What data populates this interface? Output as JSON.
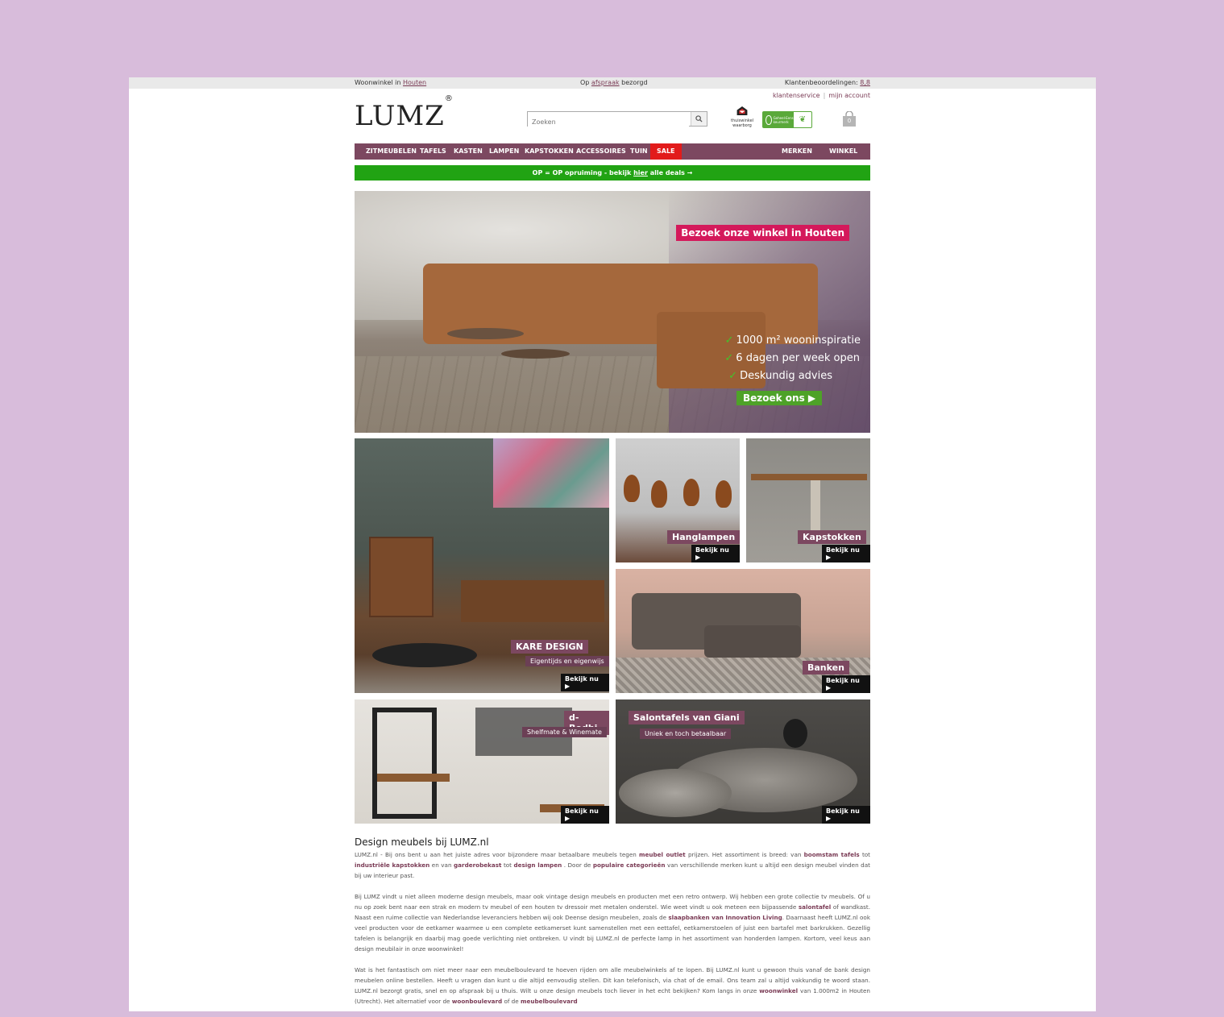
{
  "topbar": {
    "left_prefix": "Woonwinkel in",
    "left_link": "Houten",
    "center_prefix": "Op",
    "center_link": "afspraak",
    "center_suffix": "bezorgd",
    "right_prefix": "Klantenbeoordelingen:",
    "right_rating": "8,8"
  },
  "header": {
    "logo": "LUMZ",
    "logo_mark": "®",
    "account_links": [
      "klantenservice",
      "mijn account"
    ],
    "search_placeholder": "Zoeken",
    "thuiswinkel_label": "thuiswinkel waarborg",
    "keurmerk_label": "Geheel-Eens keurmerk",
    "cart_count": "0"
  },
  "nav": {
    "items": [
      "ZITMEUBELEN",
      "TAFELS",
      "KASTEN",
      "LAMPEN",
      "KAPSTOKKEN",
      "ACCESSOIRES",
      "TUIN",
      "SALE"
    ],
    "right_items": [
      "MERKEN",
      "WINKEL"
    ]
  },
  "promo": {
    "prefix": "OP = OP opruiming - bekijk",
    "link": "hier",
    "suffix": "alle deals →"
  },
  "hero": {
    "tag": "Bezoek onze winkel in Houten",
    "features": [
      "1000 m² wooninspiratie",
      "6 dagen per week open",
      "Deskundig advies"
    ],
    "cta": "Bezoek ons ▶"
  },
  "tiles": {
    "kare": {
      "title": "KARE DESIGN",
      "sub": "Eigentijds en eigenwijs",
      "cta": "Bekijk nu ▶"
    },
    "hanglampen": {
      "title": "Hanglampen",
      "cta": "Bekijk nu ▶"
    },
    "kapstokken": {
      "title": "Kapstokken",
      "cta": "Bekijk nu ▶"
    },
    "banken": {
      "title": "Banken",
      "cta": "Bekijk nu ▶"
    },
    "dbodhi": {
      "title": "d-Bodhi",
      "sub": "Shelfmate & Winemate",
      "cta": "Bekijk nu ▶"
    },
    "giani": {
      "title": "Salontafels van Giani",
      "sub": "Uniek en toch betaalbaar",
      "cta": "Bekijk nu ▶"
    }
  },
  "content": {
    "heading": "Design meubels bij LUMZ.nl",
    "p1": {
      "t1": "LUMZ.nl - Bij ons bent u aan het juiste adres voor bijzondere maar betaalbare meubels tegen ",
      "l1": "meubel outlet",
      "t2": " prijzen. Het assortiment is breed: van ",
      "l2": "boomstam tafels",
      "t3": " tot ",
      "l3": "industriële kapstokken",
      "t4": " en van ",
      "l4": "garderobekast",
      "t5": " tot ",
      "l5": "design lampen",
      "t6": " . Door de ",
      "l6": "populaire categorieën",
      "t7": " van verschillende merken kunt u altijd een design meubel vinden dat bij uw interieur past."
    },
    "p2": {
      "t1": "Bij LUMZ vindt u niet alleen moderne design meubels, maar ook vintage design meubels en producten met een retro ontwerp. Wij hebben een grote collectie tv meubels. Of u nu op zoek bent naar een strak en modern tv meubel of een houten tv dressoir met metalen onderstel. Wie weet vindt u ook meteen een bijpassende ",
      "l1": "salontafel",
      "t2": " of wandkast. Naast een ruime collectie van Nederlandse leveranciers hebben wij ook Deense design meubelen, zoals de ",
      "l2": "slaapbanken van Innovation Living",
      "t3": ". Daarnaast heeft LUMZ.nl ook veel producten voor de eetkamer waarmee u een complete eetkamerset kunt samenstellen met een eettafel, eetkamerstoelen of juist een bartafel met barkrukken. Gezellig tafelen is belangrijk en daarbij mag goede verlichting niet ontbreken. U vindt bij LUMZ.nl de perfecte lamp in het assortiment van honderden lampen. Kortom, veel keus aan design meubilair in onze woonwinkel!"
    },
    "p3": {
      "t1": "Wat is het fantastisch om niet meer naar een meubelboulevard te hoeven rijden om alle meubelwinkels af te lopen. Bij LUMZ.nl kunt u gewoon thuis vanaf de bank design meubelen online bestellen. Heeft u vragen dan kunt u die altijd eenvoudig stellen. Dit kan telefonisch, via chat of de email. Ons team zal u altijd vakkundig te woord staan. LUMZ.nl bezorgt gratis, snel en op afspraak bij u thuis. Wilt u onze design meubels toch liever in het echt bekijken? Kom langs in onze ",
      "l1": "woonwinkel",
      "t2": " van 1.000m2 in Houten (Utrecht). Het alternatief voor de ",
      "l2": "woonboulevard",
      "t3": "  of de ",
      "l3": "meubelboulevard"
    }
  },
  "colors": {
    "background": "#d8bcdb",
    "brand": "#7c4860",
    "promo_green": "#21a313",
    "sale_red": "#e21b1b",
    "hero_tag": "#d4195b",
    "cta_green": "#4ea228"
  }
}
